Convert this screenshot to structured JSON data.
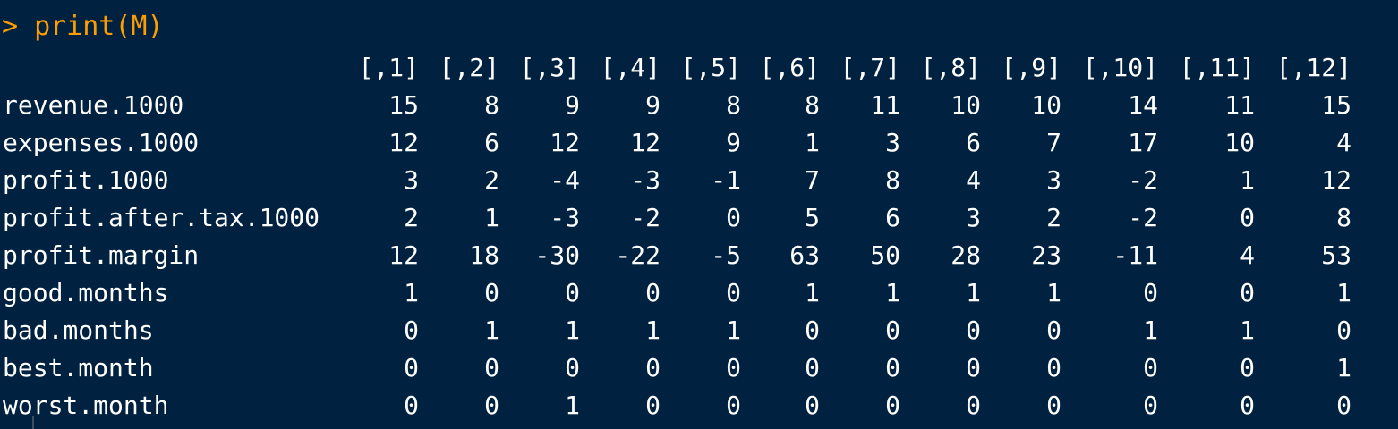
{
  "console": {
    "prompt_symbol": ">",
    "command": "print(M)",
    "top_remnant": ")"
  },
  "matrix": {
    "columns": [
      "[,1]",
      "[,2]",
      "[,3]",
      "[,4]",
      "[,5]",
      "[,6]",
      "[,7]",
      "[,8]",
      "[,9]",
      "[,10]",
      "[,11]",
      "[,12]"
    ],
    "rows": [
      {
        "name": "revenue.1000",
        "values": [
          "15",
          "8",
          "9",
          "9",
          "8",
          "8",
          "11",
          "10",
          "10",
          "14",
          "11",
          "15"
        ]
      },
      {
        "name": "expenses.1000",
        "values": [
          "12",
          "6",
          "12",
          "12",
          "9",
          "1",
          "3",
          "6",
          "7",
          "17",
          "10",
          "4"
        ]
      },
      {
        "name": "profit.1000",
        "values": [
          "3",
          "2",
          "-4",
          "-3",
          "-1",
          "7",
          "8",
          "4",
          "3",
          "-2",
          "1",
          "12"
        ]
      },
      {
        "name": "profit.after.tax.1000",
        "values": [
          "2",
          "1",
          "-3",
          "-2",
          "0",
          "5",
          "6",
          "3",
          "2",
          "-2",
          "0",
          "8"
        ]
      },
      {
        "name": "profit.margin",
        "values": [
          "12",
          "18",
          "-30",
          "-22",
          "-5",
          "63",
          "50",
          "28",
          "23",
          "-11",
          "4",
          "53"
        ]
      },
      {
        "name": "good.months",
        "values": [
          "1",
          "0",
          "0",
          "0",
          "0",
          "1",
          "1",
          "1",
          "1",
          "0",
          "0",
          "1"
        ]
      },
      {
        "name": "bad.months",
        "values": [
          "0",
          "1",
          "1",
          "1",
          "1",
          "0",
          "0",
          "0",
          "0",
          "1",
          "1",
          "0"
        ]
      },
      {
        "name": "best.month",
        "values": [
          "0",
          "0",
          "0",
          "0",
          "0",
          "0",
          "0",
          "0",
          "0",
          "0",
          "0",
          "1"
        ]
      },
      {
        "name": "worst.month",
        "values": [
          "0",
          "0",
          "1",
          "0",
          "0",
          "0",
          "0",
          "0",
          "0",
          "0",
          "0",
          "0"
        ]
      }
    ]
  },
  "colors": {
    "background": "#002240",
    "prompt": "#ff9d00",
    "output": "#ffffff"
  }
}
